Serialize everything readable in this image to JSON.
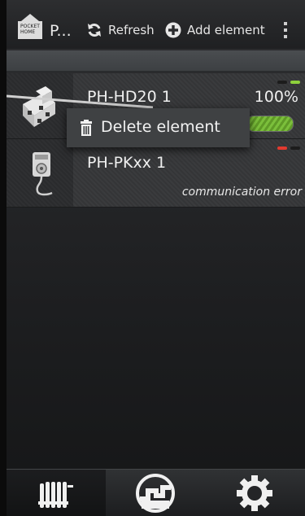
{
  "app": {
    "logo_text": "POCKET HOME",
    "title": "P...",
    "refresh_label": "Refresh",
    "add_element_label": "Add element"
  },
  "devices": [
    {
      "name": "PH-HD20 1",
      "value_text": "100%",
      "progress": 1.0,
      "leds": [
        "#1c1c1c",
        "#8ed13c"
      ],
      "icon": "thermostat-head-icon"
    },
    {
      "name": "PH-PKxx 1",
      "status": "communication error",
      "leds": [
        "#e23a2f",
        "#1c1c1c"
      ],
      "icon": "wall-plug-icon"
    }
  ],
  "context_menu": {
    "delete_label": "Delete element"
  },
  "tabs": [
    {
      "name": "radiator",
      "icon": "radiator-icon",
      "active": true
    },
    {
      "name": "heating-mode",
      "icon": "gauge-icon",
      "active": false
    },
    {
      "name": "settings",
      "icon": "gear-icon",
      "active": false
    }
  ],
  "colors": {
    "accent_green": "#7bbf3b",
    "error_red": "#e23a2f"
  }
}
